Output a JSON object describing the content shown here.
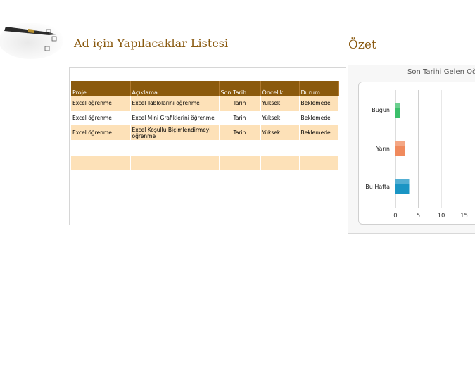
{
  "header": {
    "title": "Ad için Yapılacaklar Listesi",
    "summary_title": "Özet"
  },
  "table": {
    "columns": [
      "Proje",
      "Açıklama",
      "Son Tarih",
      "Öncelik",
      "Durum"
    ],
    "rows": [
      [
        "Excel öğrenme",
        "Excel Tablolarını öğrenme",
        "Tarih",
        "Yüksek",
        "Beklemede"
      ],
      [
        "Excel öğrenme",
        "Excel Mini Grafiklerini öğrenme",
        "Tarih",
        "Yüksek",
        "Beklemede"
      ],
      [
        "Excel öğrenme",
        "Excel Koşullu Biçimlendirmeyi öğrenme",
        "Tarih",
        "Yüksek",
        "Beklemede"
      ]
    ]
  },
  "chart_data": {
    "type": "bar",
    "orientation": "horizontal",
    "title": "Son Tarihi Gelen Öğe",
    "categories": [
      "Bugün",
      "Yarın",
      "Bu Hafta"
    ],
    "values": [
      1,
      2,
      3
    ],
    "x_ticks": [
      "0",
      "5",
      "10",
      "15"
    ],
    "xlim": [
      0,
      15
    ],
    "grid": true,
    "bar_colors": [
      "#3bbf6a",
      "#f08a5d",
      "#1a95c4"
    ]
  }
}
